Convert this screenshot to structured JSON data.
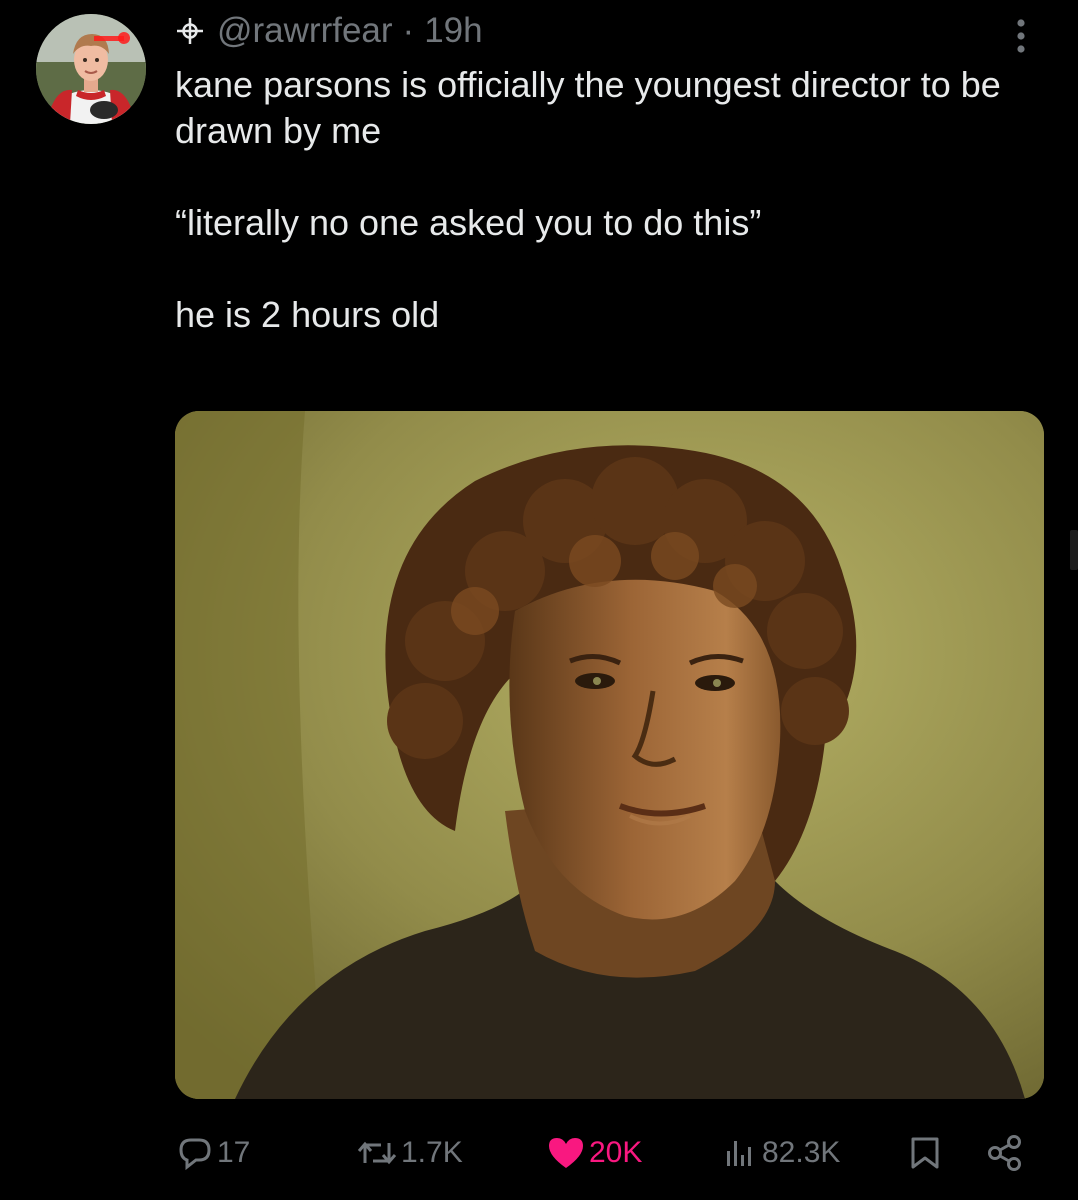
{
  "tweet": {
    "author": {
      "handle": "@rawrrfear",
      "avatar_icon": "user-avatar"
    },
    "separator": "·",
    "time": "19h",
    "text": [
      "kane parsons is officially the youngest director to be drawn by me",
      "“literally no one asked you to do this”",
      "he is 2 hours old"
    ],
    "media": {
      "type": "painting-portrait",
      "colors": {
        "background": "#8c8744",
        "hair": "#4a2a12",
        "skin": "#a2693a",
        "shirt": "#2a2318"
      }
    },
    "stats": {
      "replies": "17",
      "reposts": "1.7K",
      "likes": "20K",
      "views": "82.3K"
    },
    "liked": true,
    "icons": {
      "reply": "reply-bubble-icon",
      "repost": "repost-icon",
      "like": "heart-icon",
      "views": "views-bars-icon",
      "bookmark": "bookmark-icon",
      "share": "share-icon",
      "more": "more-vertical-icon",
      "handle_prefix": "crosshair-icon"
    },
    "colors": {
      "background": "#000000",
      "text": "#e7e9ea",
      "muted": "#71767b",
      "like": "#f91880"
    }
  }
}
